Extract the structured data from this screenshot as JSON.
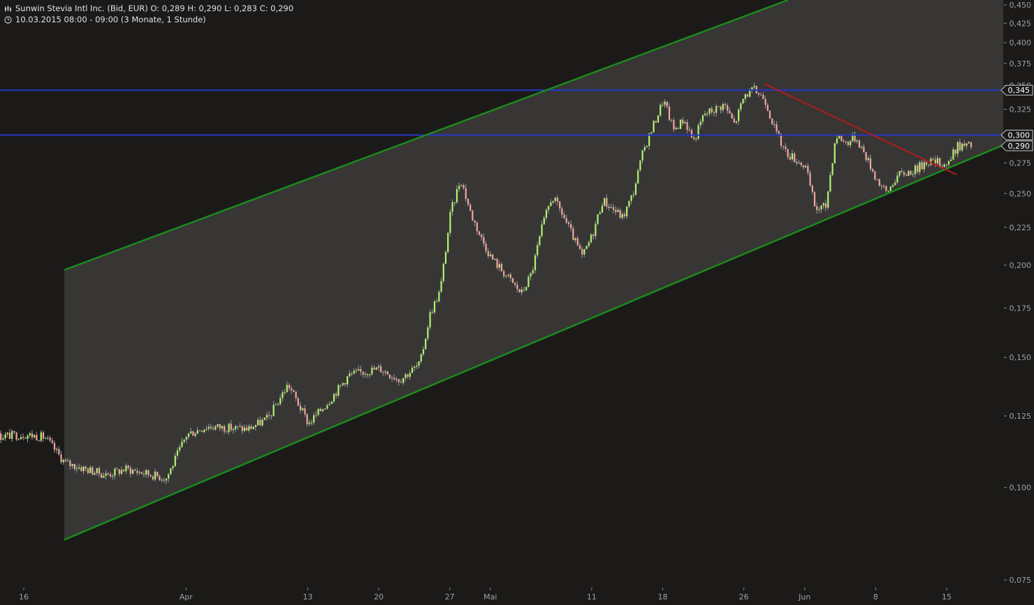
{
  "header": {
    "title_line": "Sunwin Stevia Intl Inc. (Bid, EUR)  O: 0,289  H: 0,290  L: 0,283  C: 0,290",
    "period_line": "10.03.2015 08:00 - 09:00 (3 Monate, 1 Stunde)"
  },
  "colors": {
    "background": "#1b1a19",
    "channel_fill": "#373635",
    "channel_line": "#1c8a1c",
    "resistance_line": "#2436c8",
    "downtrend_line": "#b01c1c",
    "candle_up": "#b2f56e",
    "candle_down": "#f5a5a3",
    "axis_text": "#a0a0a0"
  },
  "chart_data": {
    "type": "candlestick",
    "title": "Sunwin Stevia Intl Inc. (Bid, EUR)",
    "y_scale": "log",
    "ylim": [
      0.07,
      0.45
    ],
    "y_ticks": [
      "0,450",
      "0,425",
      "0,400",
      "0,375",
      "0,350",
      "0,325",
      "0,275",
      "0,250",
      "0,225",
      "0,200",
      "0,175",
      "0,150",
      "0,125",
      "0,100",
      "0,075"
    ],
    "y_tick_values": [
      0.45,
      0.425,
      0.4,
      0.375,
      0.35,
      0.325,
      0.275,
      0.25,
      0.225,
      0.2,
      0.175,
      0.15,
      0.125,
      0.1,
      0.075
    ],
    "x_ticks": [
      "16",
      "Apr",
      "13",
      "20",
      "27",
      "Mai",
      "11",
      "18",
      "26",
      "Jun",
      "8",
      "15"
    ],
    "x_tick_dates": [
      "2015-03-16",
      "2015-04-01",
      "2015-04-13",
      "2015-04-20",
      "2015-04-27",
      "2015-05-01",
      "2015-05-11",
      "2015-05-18",
      "2015-05-26",
      "2015-06-01",
      "2015-06-08",
      "2015-06-15"
    ],
    "last": {
      "open": 0.289,
      "high": 0.29,
      "low": 0.283,
      "close": 0.29
    },
    "price_tags": [
      {
        "label": "0,345",
        "value": 0.345
      },
      {
        "label": "0,300",
        "value": 0.3
      },
      {
        "label": "0,290",
        "value": 0.29
      }
    ],
    "horizontal_lines": [
      0.345,
      0.3
    ],
    "channel": {
      "start_date": "2015-03-20",
      "upper": [
        [
          "2015-03-20",
          0.197
        ],
        [
          "2015-05-30",
          0.455
        ]
      ],
      "lower": [
        [
          "2015-03-20",
          0.085
        ],
        [
          "2015-06-18",
          0.281
        ]
      ]
    },
    "downtrend": [
      [
        "2015-05-28",
        0.352
      ],
      [
        "2015-06-16",
        0.265
      ]
    ],
    "series_close": [
      [
        "2015-03-10",
        0.113
      ],
      [
        "2015-03-12",
        0.117
      ],
      [
        "2015-03-16",
        0.118
      ],
      [
        "2015-03-18",
        0.117
      ],
      [
        "2015-03-20",
        0.108
      ],
      [
        "2015-03-24",
        0.104
      ],
      [
        "2015-03-26",
        0.106
      ],
      [
        "2015-03-30",
        0.103
      ],
      [
        "2015-04-01",
        0.118
      ],
      [
        "2015-04-03",
        0.121
      ],
      [
        "2015-04-07",
        0.12
      ],
      [
        "2015-04-09",
        0.124
      ],
      [
        "2015-04-11",
        0.138
      ],
      [
        "2015-04-13",
        0.122
      ],
      [
        "2015-04-15",
        0.131
      ],
      [
        "2015-04-17",
        0.142
      ],
      [
        "2015-04-20",
        0.145
      ],
      [
        "2015-04-22",
        0.14
      ],
      [
        "2015-04-24",
        0.147
      ],
      [
        "2015-04-25",
        0.172
      ],
      [
        "2015-04-26",
        0.185
      ],
      [
        "2015-04-27",
        0.235
      ],
      [
        "2015-04-28",
        0.262
      ],
      [
        "2015-04-29",
        0.235
      ],
      [
        "2015-04-30",
        0.218
      ],
      [
        "2015-05-01",
        0.205
      ],
      [
        "2015-05-04",
        0.183
      ],
      [
        "2015-05-05",
        0.195
      ],
      [
        "2015-05-06",
        0.224
      ],
      [
        "2015-05-07",
        0.248
      ],
      [
        "2015-05-08",
        0.235
      ],
      [
        "2015-05-10",
        0.205
      ],
      [
        "2015-05-11",
        0.22
      ],
      [
        "2015-05-12",
        0.245
      ],
      [
        "2015-05-14",
        0.232
      ],
      [
        "2015-05-15",
        0.25
      ],
      [
        "2015-05-16",
        0.285
      ],
      [
        "2015-05-18",
        0.335
      ],
      [
        "2015-05-19",
        0.305
      ],
      [
        "2015-05-20",
        0.315
      ],
      [
        "2015-05-21",
        0.295
      ],
      [
        "2015-05-22",
        0.32
      ],
      [
        "2015-05-24",
        0.33
      ],
      [
        "2015-05-25",
        0.31
      ],
      [
        "2015-05-26",
        0.34
      ],
      [
        "2015-05-27",
        0.345
      ],
      [
        "2015-05-28",
        0.336
      ],
      [
        "2015-05-29",
        0.305
      ],
      [
        "2015-05-30",
        0.285
      ],
      [
        "2015-06-01",
        0.272
      ],
      [
        "2015-06-02",
        0.238
      ],
      [
        "2015-06-03",
        0.24
      ],
      [
        "2015-06-04",
        0.3
      ],
      [
        "2015-06-05",
        0.293
      ],
      [
        "2015-06-06",
        0.298
      ],
      [
        "2015-06-07",
        0.28
      ],
      [
        "2015-06-08",
        0.262
      ],
      [
        "2015-06-09",
        0.25
      ],
      [
        "2015-06-10",
        0.264
      ],
      [
        "2015-06-12",
        0.27
      ],
      [
        "2015-06-13",
        0.277
      ],
      [
        "2015-06-15",
        0.274
      ],
      [
        "2015-06-16",
        0.29
      ]
    ]
  }
}
